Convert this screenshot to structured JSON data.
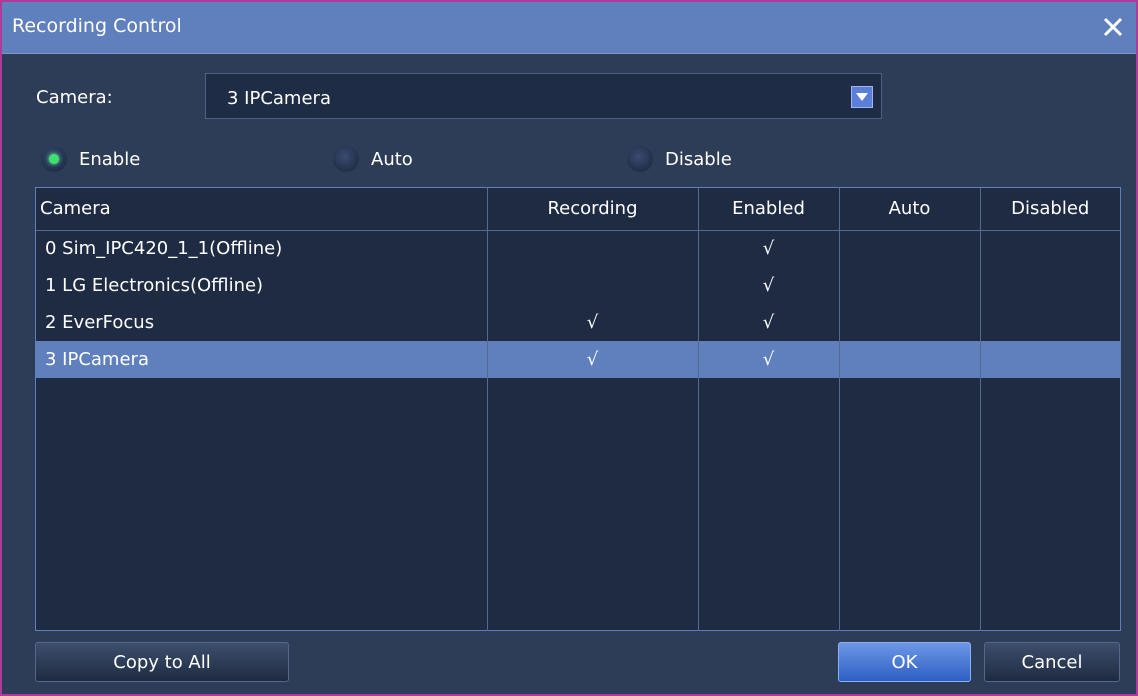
{
  "dialog": {
    "title": "Recording Control",
    "close_icon": "close-icon"
  },
  "camera_select": {
    "label": "Camera:",
    "value": "3 IPCamera"
  },
  "mode_radios": [
    {
      "label": "Enable",
      "checked": true
    },
    {
      "label": "Auto",
      "checked": false
    },
    {
      "label": "Disable",
      "checked": false
    }
  ],
  "table": {
    "headers": [
      "Camera",
      "Recording",
      "Enabled",
      "Auto",
      "Disabled"
    ],
    "rows": [
      {
        "camera": "0 Sim_IPC420_1_1(Offline)",
        "recording": "",
        "enabled": "√",
        "auto": "",
        "disabled": "",
        "selected": false
      },
      {
        "camera": "1 LG Electronics(Offline)",
        "recording": "",
        "enabled": "√",
        "auto": "",
        "disabled": "",
        "selected": false
      },
      {
        "camera": "2 EverFocus",
        "recording": "√",
        "enabled": "√",
        "auto": "",
        "disabled": "",
        "selected": false
      },
      {
        "camera": "3 IPCamera",
        "recording": "√",
        "enabled": "√",
        "auto": "",
        "disabled": "",
        "selected": true
      }
    ]
  },
  "buttons": {
    "copy_to_all": "Copy to All",
    "ok": "OK",
    "cancel": "Cancel"
  },
  "colors": {
    "titlebar": "#5f7fbd",
    "background": "#2d3c57",
    "selected_row": "#5f7fbd",
    "radio_checked": "#3fe070",
    "frame": "#b03a9a"
  }
}
